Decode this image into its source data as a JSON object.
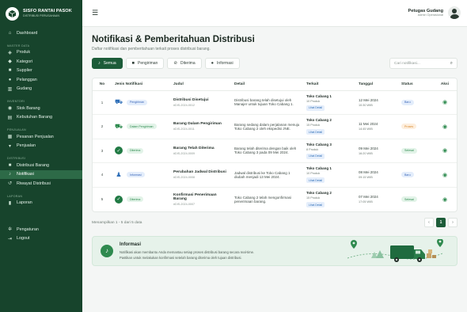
{
  "brand": {
    "title": "SISFO RANTAI PASOK",
    "subtitle": "DISTRIBUSI PERUSAHAAN"
  },
  "sidebar": {
    "dashboard": "Dashboard",
    "section_master": "MASTER DATA",
    "produk": "Produk",
    "kategori": "Kategori",
    "supplier": "Supplier",
    "pelanggan": "Pelanggan",
    "gudang": "Gudang",
    "section_inventori": "INVENTORI",
    "stok_barang": "Stok Barang",
    "kebutuhan_barang": "Kebutuhan Barang",
    "section_penjualan": "PENJUALAN",
    "pesanan_penjualan": "Pesanan Penjualan",
    "penjualan": "Penjualan",
    "section_distribusi": "DISTRIBUSI",
    "distribusi_barang": "Distribusi Barang",
    "notifikasi": "Notifikasi",
    "riwayat_distribusi": "Riwayat Distribusi",
    "section_laporan": "LAPORAN",
    "laporan": "Laporan",
    "pengaturan": "Pengaturan",
    "logout": "Logout"
  },
  "user": {
    "name": "Petugas Gudang",
    "role": "Admin Operasional"
  },
  "page": {
    "title": "Notifikasi & Pemberitahuan Distribusi",
    "subtitle": "Daftar notifikasi dan pemberitahuan terkait proses distribusi barang."
  },
  "filters": {
    "semua": "Semua",
    "pengiriman": "Pengiriman",
    "diterima": "Diterima",
    "informasi": "Informasi",
    "search_placeholder": "Cari notifikasi..."
  },
  "table": {
    "headers": {
      "no": "No",
      "jenis": "Jenis Notifikasi",
      "judul": "Judul",
      "detail": "Detail",
      "terkait": "Terkait",
      "tanggal": "Tanggal",
      "status": "Status",
      "aksi": "Aksi"
    },
    "rows": [
      {
        "no": "1",
        "jenis": "Pengiriman",
        "judul": "Distribusi Disetujui",
        "kode": "#DIS-2024-0012",
        "detail": "Distribusi barang telah disetujui oleh Manajer untuk tujuan Toko Cabang 1.",
        "terkait": "Toko Cabang 1",
        "produk": "10 Produk",
        "lihat": "Lihat Detail",
        "tanggal": "12 Mei 2024",
        "jam": "10:30 WIB",
        "status": "Baru"
      },
      {
        "no": "2",
        "jenis": "Dalam Pengiriman",
        "judul": "Barang Dalam Pengiriman",
        "kode": "#DIS-2024-0011",
        "detail": "Barang sedang dalam perjalanan menuju Toko Cabang 2 oleh ekspedisi JNE.",
        "terkait": "Toko Cabang 2",
        "produk": "15 Produk",
        "lihat": "Lihat Detail",
        "tanggal": "11 Mei 2024",
        "jam": "14:45 WIB",
        "status": "Proses"
      },
      {
        "no": "3",
        "jenis": "Diterima",
        "judul": "Barang Telah Diterima",
        "kode": "#DIS-2024-0009",
        "detail": "Barang telah diterima dengan baik oleh Toko Cabang 3 pada 09 Mei 2024.",
        "terkait": "Toko Cabang 3",
        "produk": "8 Produk",
        "lihat": "Lihat Detail",
        "tanggal": "09 Mei 2024",
        "jam": "16:20 WIB",
        "status": "Selesai"
      },
      {
        "no": "4",
        "jenis": "Informasi",
        "judul": "Perubahan Jadwal Distribusi",
        "kode": "#DIS-2024-0008",
        "detail": "Jadwal distribusi ke Toko Cabang 1 diubah menjadi 13 Mei 2024.",
        "terkait": "Toko Cabang 1",
        "produk": "10 Produk",
        "lihat": "Lihat Detail",
        "tanggal": "08 Mei 2024",
        "jam": "09:15 WIB",
        "status": "Baru"
      },
      {
        "no": "5",
        "jenis": "Diterima",
        "judul": "Konfirmasi Penerimaan Barang",
        "kode": "#DIS-2024-0007",
        "detail": "Toko Cabang 2 telah mengonfirmasi penerimaan barang.",
        "terkait": "Toko Cabang 2",
        "produk": "15 Produk",
        "lihat": "Lihat Detail",
        "tanggal": "07 Mei 2024",
        "jam": "17:05 WIB",
        "status": "Selesai"
      }
    ]
  },
  "pagination": {
    "info": "Menampilkan 1 - 5 dari 5 data",
    "prev": "‹",
    "current": "1",
    "next": "›"
  },
  "info_box": {
    "title": "Informasi",
    "line1": "Notifikasi akan membantu Anda memantau setiap proses distribusi barang secara real-time.",
    "line2": "Pastikan untuk melakukan konfirmasi setelah barang diterima oleh tujuan distribusi."
  },
  "colors": {
    "sidebar": "#17442c",
    "accent": "#1d5c39",
    "blue_badge": "#3a66b8",
    "green_badge": "#2d8a4e",
    "orange_badge": "#d98a2c"
  }
}
